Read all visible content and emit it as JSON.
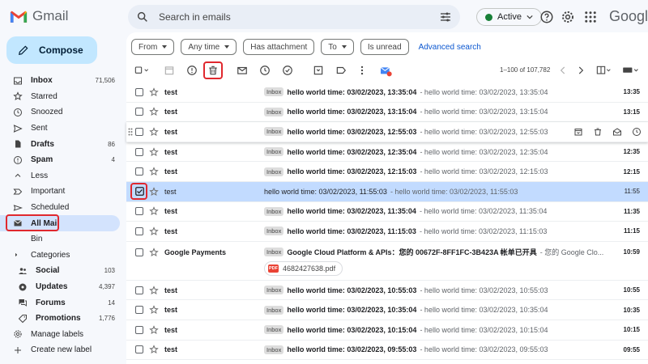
{
  "app": {
    "name": "Gmail"
  },
  "header": {
    "search_placeholder": "Search in emails",
    "status": "Active",
    "brand": "Google"
  },
  "sidebar": {
    "compose": "Compose",
    "items": [
      {
        "label": "Inbox",
        "count": "71,506",
        "icon": "inbox-icon",
        "bold": true
      },
      {
        "label": "Starred",
        "count": "",
        "icon": "star-icon"
      },
      {
        "label": "Snoozed",
        "count": "",
        "icon": "clock-icon"
      },
      {
        "label": "Sent",
        "count": "",
        "icon": "send-icon"
      },
      {
        "label": "Drafts",
        "count": "86",
        "icon": "draft-icon",
        "bold": true
      },
      {
        "label": "Spam",
        "count": "4",
        "icon": "spam-icon",
        "bold": true
      },
      {
        "label": "Less",
        "count": "",
        "icon": "chevron-up-icon"
      },
      {
        "label": "Important",
        "count": "",
        "icon": "important-icon"
      },
      {
        "label": "Scheduled",
        "count": "",
        "icon": "scheduled-icon"
      },
      {
        "label": "All Mail",
        "count": "",
        "icon": "all-mail-icon",
        "bold": true,
        "selected": true
      },
      {
        "label": "Bin",
        "count": "",
        "icon": "bin-icon"
      },
      {
        "label": "Categories",
        "count": "",
        "icon": "label-icon"
      },
      {
        "label": "Social",
        "count": "103",
        "icon": "social-icon",
        "bold": true,
        "sub": true
      },
      {
        "label": "Updates",
        "count": "4,397",
        "icon": "updates-icon",
        "bold": true,
        "sub": true
      },
      {
        "label": "Forums",
        "count": "14",
        "icon": "forums-icon",
        "bold": true,
        "sub": true
      },
      {
        "label": "Promotions",
        "count": "1,776",
        "icon": "promotions-icon",
        "bold": true,
        "sub": true
      },
      {
        "label": "Manage labels",
        "count": "",
        "icon": "gear-icon"
      },
      {
        "label": "Create new label",
        "count": "",
        "icon": "plus-icon"
      }
    ]
  },
  "filters": {
    "from": "From",
    "any_time": "Any time",
    "has_attachment": "Has attachment",
    "to": "To",
    "is_unread": "Is unread",
    "advanced": "Advanced search"
  },
  "toolbar": {
    "pagination": "1–100 of 107,782"
  },
  "emails": [
    {
      "sender": "test",
      "badge": "Inbox",
      "subject": "hello world time: 03/02/2023, 13:35:04",
      "snippet": "- hello world time: 03/02/2023, 13:35:04",
      "time": "13:35"
    },
    {
      "sender": "test",
      "badge": "Inbox",
      "subject": "hello world time: 03/02/2023, 13:15:04",
      "snippet": "- hello world time: 03/02/2023, 13:15:04",
      "time": "13:15"
    },
    {
      "sender": "test",
      "badge": "Inbox",
      "subject": "hello world time: 03/02/2023, 12:55:03",
      "snippet": "- hello world time: 03/02/2023, 12:55:03",
      "time": ""
    },
    {
      "sender": "test",
      "badge": "Inbox",
      "subject": "hello world time: 03/02/2023, 12:35:04",
      "snippet": "- hello world time: 03/02/2023, 12:35:04",
      "time": "12:35"
    },
    {
      "sender": "test",
      "badge": "Inbox",
      "subject": "hello world time: 03/02/2023, 12:15:03",
      "snippet": "- hello world time: 03/02/2023, 12:15:03",
      "time": "12:15"
    },
    {
      "sender": "test",
      "badge": "",
      "subject": "hello world time: 03/02/2023, 11:55:03",
      "snippet": "- hello world time: 03/02/2023, 11:55:03",
      "time": "11:55"
    },
    {
      "sender": "test",
      "badge": "Inbox",
      "subject": "hello world time: 03/02/2023, 11:35:04",
      "snippet": "- hello world time: 03/02/2023, 11:35:04",
      "time": "11:35"
    },
    {
      "sender": "test",
      "badge": "Inbox",
      "subject": "hello world time: 03/02/2023, 11:15:03",
      "snippet": "- hello world time: 03/02/2023, 11:15:03",
      "time": "11:15"
    },
    {
      "sender": "Google Payments",
      "badge": "Inbox",
      "subject": "Google Cloud Platform & APIs：您的 00672F-8FF1FC-3B423A 帐单已开具",
      "snippet": "- 您的 Google Clo...",
      "time": "10:59",
      "attachment": "4682427638.pdf"
    },
    {
      "sender": "test",
      "badge": "Inbox",
      "subject": "hello world time: 03/02/2023, 10:55:03",
      "snippet": "- hello world time: 03/02/2023, 10:55:03",
      "time": "10:55"
    },
    {
      "sender": "test",
      "badge": "Inbox",
      "subject": "hello world time: 03/02/2023, 10:35:04",
      "snippet": "- hello world time: 03/02/2023, 10:35:04",
      "time": "10:35"
    },
    {
      "sender": "test",
      "badge": "Inbox",
      "subject": "hello world time: 03/02/2023, 10:15:04",
      "snippet": "- hello world time: 03/02/2023, 10:15:04",
      "time": "10:15"
    },
    {
      "sender": "test",
      "badge": "Inbox",
      "subject": "hello world time: 03/02/2023, 09:55:03",
      "snippet": "- hello world time: 03/02/2023, 09:55:03",
      "time": "09:55"
    }
  ],
  "colors": {
    "accent": "#0b57d0",
    "highlight": "#e0282e",
    "selected_row": "#c2dbff",
    "compose": "#c2e7ff"
  }
}
